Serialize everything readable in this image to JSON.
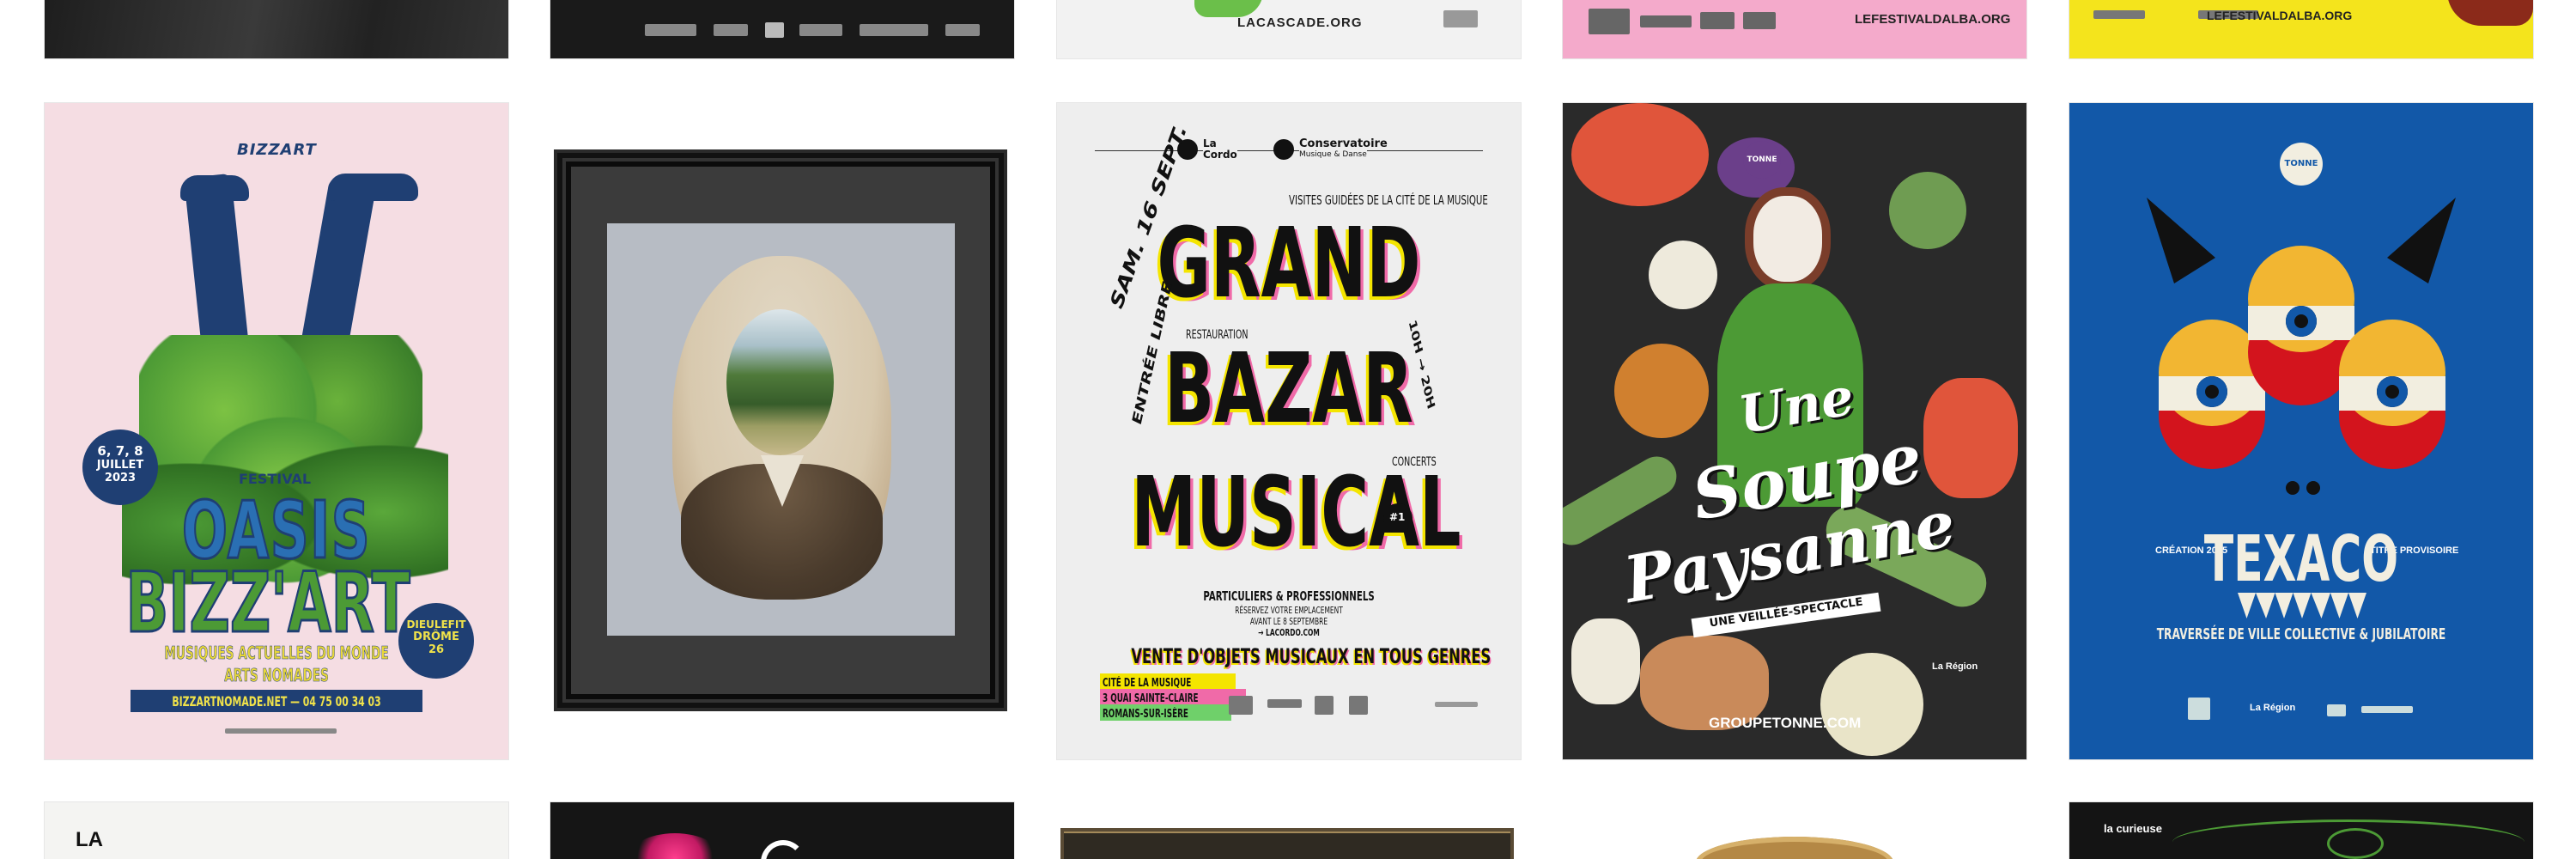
{
  "row_top": {
    "t3_site": "LACASCADE.ORG",
    "t4_site": "LEFESTIVALDALBA.ORG",
    "t5_site": "LEFESTIVALDALBA.ORG"
  },
  "oasis": {
    "brand": "BIZZART",
    "dates": "6, 7, 8",
    "month": "JUILLET",
    "year": "2023",
    "festival": "FESTIVAL",
    "title_1": "OASIS",
    "title_2": "BIZZ'ART",
    "place_1": "DIEULEFIT",
    "place_2": "DRÔME",
    "place_3": "26",
    "sub_1": "MUSIQUES ACTUELLES DU MONDE",
    "sub_2": "ARTS NOMADES",
    "contact": "BIZZARTNOMADE.NET — 04 75 00 34 03"
  },
  "bazar": {
    "logo_1_a": "La",
    "logo_1_b": "Cordo",
    "logo_2_a": "Conservatoire",
    "logo_2_b": "Musique & Danse",
    "date": "SAM. 16 SEPT.",
    "visits": "VISITES GUIDÉES DE LA CITÉ DE LA MUSIQUE",
    "line_1": "GRAND",
    "line_2": "BAZAR",
    "line_3": "MUSICAL",
    "resto": "RESTAURATION",
    "entry": "ENTRÉE LIBRE",
    "hours": "10H → 20H",
    "concerts": "CONCERTS",
    "edition": "#1",
    "pros": "PARTICULIERS & PROFESSIONNELS",
    "reserve_1": "RÉSERVEZ VOTRE EMPLACEMENT",
    "reserve_2": "AVANT LE 8 SEPTEMBRE",
    "reserve_3": "→ LACORDO.COM",
    "sale": "VENTE D'OBJETS MUSICAUX EN TOUS GENRES",
    "addr_1": "CITÉ DE LA MUSIQUE",
    "addr_2": "3 QUAI SAINTE-CLAIRE",
    "addr_3": "ROMANS-SUR-ISÈRE"
  },
  "soupe": {
    "badge": "TONNE",
    "title_1": "Une",
    "title_2": "Soupe",
    "title_3": "Paysanne",
    "subtitle": "UNE VEILLÉE-SPECTACLE",
    "site": "GROUPETONNE.COM",
    "region": "La Région"
  },
  "texaco": {
    "badge": "TONNE",
    "creation": "CRÉATION 2025",
    "provisoire": "TITRE PROVISOIRE",
    "title": "TEXACO",
    "subtitle": "TRAVERSÉE DE VILLE COLLECTIVE & JUBILATOIRE",
    "region": "La Région"
  },
  "row_bottom": {
    "t1_text": "LA",
    "t5_brand": "la curieuse"
  },
  "colors": {
    "pink_bg": "#f5dde3",
    "navy": "#1f3f73",
    "green": "#4c9a35",
    "yellow": "#f4e500",
    "soup_bg": "#2a2a2a",
    "texaco_blue": "#1258a8",
    "texaco_red": "#d3141d",
    "texaco_yellow": "#f2b632"
  }
}
